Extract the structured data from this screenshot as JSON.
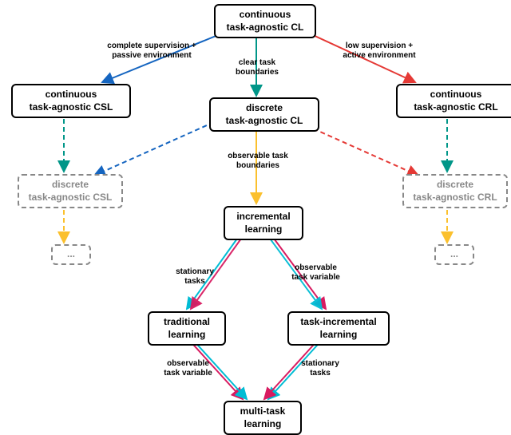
{
  "nodes": {
    "root": "continuous\ntask-agnostic CL",
    "csl": "continuous\ntask-agnostic CSL",
    "dcl": "discrete\ntask-agnostic CL",
    "crl": "continuous\ntask-agnostic CRL",
    "dcsl": "discrete\ntask-agnostic CSL",
    "dcrl": "discrete\ntask-agnostic CRL",
    "dots1": "...",
    "dots2": "...",
    "inc": "incremental\nlearning",
    "trad": "traditional\nlearning",
    "til": "task-incremental\nlearning",
    "mtl": "multi-task\nlearning"
  },
  "edges": {
    "e1": "complete supervision +\npassive environment",
    "e2": "clear task\nboundaries",
    "e3": "low supervision +\nactive environment",
    "e4": "observable task\nboundaries",
    "e5": "stationary\ntasks",
    "e6": "observable\ntask variable",
    "e7": "observable\ntask variable",
    "e8": "stationary\ntasks"
  },
  "chart_data": {
    "type": "tree-diagram",
    "title": "",
    "nodes": [
      {
        "id": "root",
        "label": "continuous task-agnostic CL",
        "style": "solid"
      },
      {
        "id": "csl",
        "label": "continuous task-agnostic CSL",
        "style": "solid"
      },
      {
        "id": "dcl",
        "label": "discrete task-agnostic CL",
        "style": "solid"
      },
      {
        "id": "crl",
        "label": "continuous task-agnostic CRL",
        "style": "solid"
      },
      {
        "id": "dcsl",
        "label": "discrete task-agnostic CSL",
        "style": "dashed"
      },
      {
        "id": "dcrl",
        "label": "discrete task-agnostic CRL",
        "style": "dashed"
      },
      {
        "id": "dots1",
        "label": "...",
        "style": "dashed"
      },
      {
        "id": "dots2",
        "label": "...",
        "style": "dashed"
      },
      {
        "id": "inc",
        "label": "incremental learning",
        "style": "solid"
      },
      {
        "id": "trad",
        "label": "traditional learning",
        "style": "solid"
      },
      {
        "id": "til",
        "label": "task-incremental learning",
        "style": "solid"
      },
      {
        "id": "mtl",
        "label": "multi-task learning",
        "style": "solid"
      }
    ],
    "edges": [
      {
        "from": "root",
        "to": "csl",
        "label": "complete supervision + passive environment",
        "color": "#1565c0",
        "style": "solid"
      },
      {
        "from": "root",
        "to": "dcl",
        "label": "clear task boundaries",
        "color": "#009688",
        "style": "solid"
      },
      {
        "from": "root",
        "to": "crl",
        "label": "low supervision + active environment",
        "color": "#e53935",
        "style": "solid"
      },
      {
        "from": "csl",
        "to": "dcsl",
        "label": "",
        "color": "#009688",
        "style": "dashed"
      },
      {
        "from": "dcl",
        "to": "dcsl",
        "label": "",
        "color": "#1565c0",
        "style": "dashed"
      },
      {
        "from": "dcl",
        "to": "dcrl",
        "label": "",
        "color": "#e53935",
        "style": "dashed"
      },
      {
        "from": "crl",
        "to": "dcrl",
        "label": "",
        "color": "#009688",
        "style": "dashed"
      },
      {
        "from": "dcsl",
        "to": "dots1",
        "label": "",
        "color": "#fbc02d",
        "style": "dashed"
      },
      {
        "from": "dcrl",
        "to": "dots2",
        "label": "",
        "color": "#fbc02d",
        "style": "dashed"
      },
      {
        "from": "dcl",
        "to": "inc",
        "label": "observable task boundaries",
        "color": "#fbc02d",
        "style": "solid"
      },
      {
        "from": "inc",
        "to": "trad",
        "label": "stationary tasks",
        "color": "#00bcd4",
        "style": "solid"
      },
      {
        "from": "inc",
        "to": "til",
        "label": "observable task variable",
        "color": "#d81b60",
        "style": "solid"
      },
      {
        "from": "trad",
        "to": "mtl",
        "label": "observable task variable",
        "color": "#d81b60",
        "style": "solid"
      },
      {
        "from": "til",
        "to": "mtl",
        "label": "stationary tasks",
        "color": "#00bcd4",
        "style": "solid"
      }
    ]
  }
}
